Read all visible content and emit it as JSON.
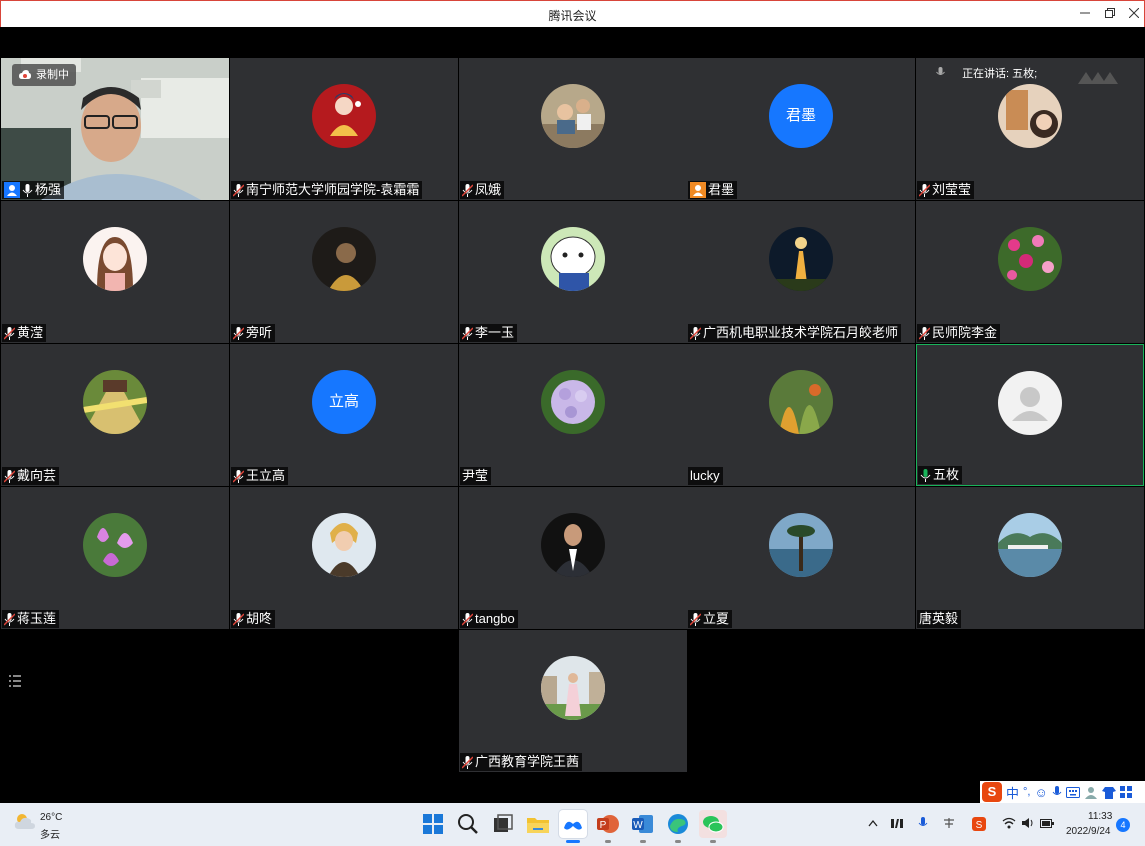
{
  "window": {
    "title": "腾讯会议"
  },
  "recording": {
    "label": "录制中"
  },
  "speaking": {
    "label": "正在讲话: 五枚;"
  },
  "participants": [
    {
      "name": "杨强",
      "kind": "video"
    },
    {
      "name": "南宁师范大学师园学院-袁霜霜",
      "kind": "image",
      "avatar": "red-illustration"
    },
    {
      "name": "凤娥",
      "kind": "image",
      "avatar": "kids-photo"
    },
    {
      "name": "君墨",
      "kind": "text",
      "avatar_text": "君墨"
    },
    {
      "name": "刘莹莹",
      "kind": "image",
      "avatar": "portrait-photo"
    },
    {
      "name": "黄滢",
      "kind": "image",
      "avatar": "cartoon-girl"
    },
    {
      "name": "旁听",
      "kind": "image",
      "avatar": "dark-portrait"
    },
    {
      "name": "李一玉",
      "kind": "image",
      "avatar": "cartoon-bear"
    },
    {
      "name": "广西机电职业技术学院石月皎老师",
      "kind": "image",
      "avatar": "night-tower"
    },
    {
      "name": "民师院李金",
      "kind": "image",
      "avatar": "flowers-photo"
    },
    {
      "name": "戴向芸",
      "kind": "image",
      "avatar": "train-photo"
    },
    {
      "name": "王立高",
      "kind": "text",
      "avatar_text": "立高"
    },
    {
      "name": "尹莹",
      "kind": "image",
      "avatar": "hydrangea"
    },
    {
      "name": "lucky",
      "kind": "image",
      "avatar": "plants-photo"
    },
    {
      "name": "五枚",
      "kind": "default",
      "avatar": "default-user"
    },
    {
      "name": "蒋玉莲",
      "kind": "image",
      "avatar": "pink-flowers"
    },
    {
      "name": "胡咚",
      "kind": "image",
      "avatar": "cartoon-character"
    },
    {
      "name": "tangbo",
      "kind": "image",
      "avatar": "man-suit"
    },
    {
      "name": "立夏",
      "kind": "image",
      "avatar": "tree-lake"
    },
    {
      "name": "唐英毅",
      "kind": "image",
      "avatar": "lake-city"
    },
    {
      "name": "广西教育学院王茜",
      "kind": "image",
      "avatar": "woman-photo"
    }
  ],
  "ime": {
    "lang": "中",
    "punct": "°,"
  },
  "taskbar": {
    "weather": {
      "temp": "26°C",
      "desc": "多云"
    },
    "clock": {
      "time": "11:33",
      "date": "2022/9/24"
    },
    "notifications": "4",
    "apps": [
      "windows-start",
      "search",
      "task-view",
      "file-explorer",
      "tencent-meeting",
      "powerpoint",
      "word",
      "edge",
      "wechat"
    ]
  },
  "colors": {
    "tile": "#2f3033",
    "accent": "#1677ff",
    "speaking": "#19b35a"
  }
}
